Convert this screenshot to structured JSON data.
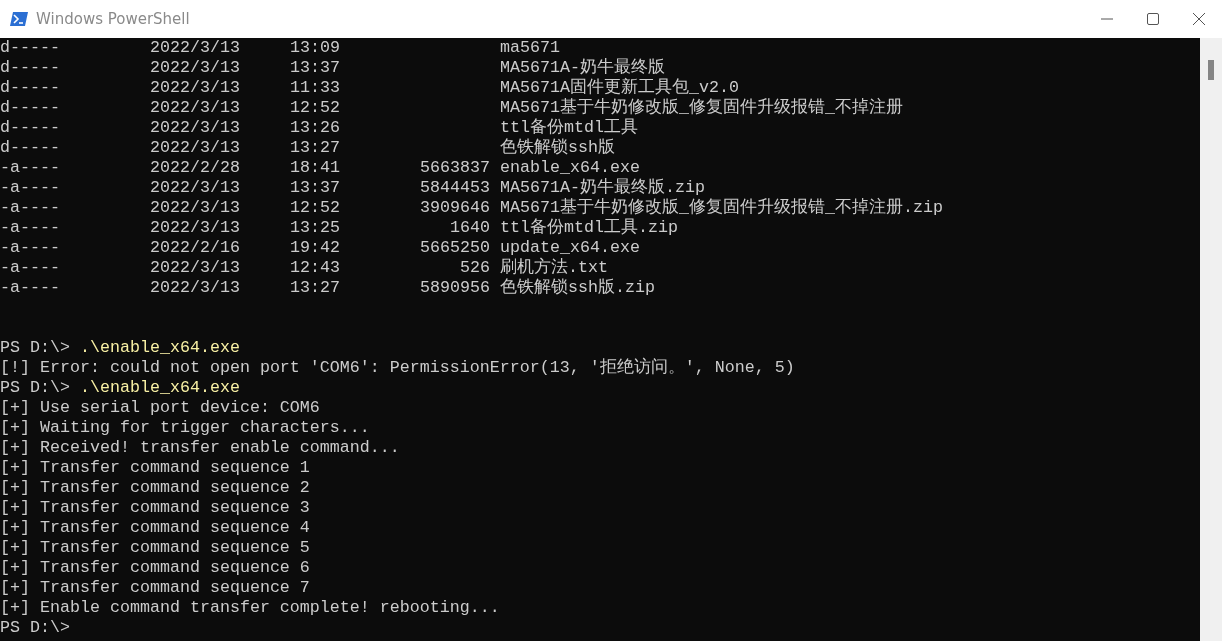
{
  "window": {
    "title": "Windows PowerShell"
  },
  "listing": [
    {
      "mode": "d-----",
      "date": "2022/3/13",
      "time": "13:09",
      "name": "ma5671"
    },
    {
      "mode": "d-----",
      "date": "2022/3/13",
      "time": "13:37",
      "name": "MA5671A-奶牛最终版"
    },
    {
      "mode": "d-----",
      "date": "2022/3/13",
      "time": "11:33",
      "name": "MA5671A固件更新工具包_v2.0"
    },
    {
      "mode": "d-----",
      "date": "2022/3/13",
      "time": "12:52",
      "name": "MA5671基于牛奶修改版_修复固件升级报错_不掉注册"
    },
    {
      "mode": "d-----",
      "date": "2022/3/13",
      "time": "13:26",
      "name": "ttl备份mtdl工具"
    },
    {
      "mode": "d-----",
      "date": "2022/3/13",
      "time": "13:27",
      "name": "色铁解锁ssh版"
    },
    {
      "mode": "-a----",
      "date": "2022/2/28",
      "time": "18:41",
      "length": "5663837",
      "name": "enable_x64.exe"
    },
    {
      "mode": "-a----",
      "date": "2022/3/13",
      "time": "13:37",
      "length": "5844453",
      "name": "MA5671A-奶牛最终版.zip"
    },
    {
      "mode": "-a----",
      "date": "2022/3/13",
      "time": "12:52",
      "length": "3909646",
      "name": "MA5671基于牛奶修改版_修复固件升级报错_不掉注册.zip"
    },
    {
      "mode": "-a----",
      "date": "2022/3/13",
      "time": "13:25",
      "length": "1640",
      "name": "ttl备份mtdl工具.zip"
    },
    {
      "mode": "-a----",
      "date": "2022/2/16",
      "time": "19:42",
      "length": "5665250",
      "name": "update_x64.exe"
    },
    {
      "mode": "-a----",
      "date": "2022/3/13",
      "time": "12:43",
      "length": "526",
      "name": "刷机方法.txt"
    },
    {
      "mode": "-a----",
      "date": "2022/3/13",
      "time": "13:27",
      "length": "5890956",
      "name": "色铁解锁ssh版.zip"
    }
  ],
  "session": [
    {
      "kind": "prompt",
      "prompt": "PS D:\\>",
      "command": ".\\enable_x64.exe"
    },
    {
      "kind": "output",
      "text": "[!] Error: could not open port 'COM6': PermissionError(13, '拒绝访问。', None, 5)"
    },
    {
      "kind": "prompt",
      "prompt": "PS D:\\>",
      "command": ".\\enable_x64.exe"
    },
    {
      "kind": "output",
      "text": "[+] Use serial port device: COM6"
    },
    {
      "kind": "output",
      "text": "[+] Waiting for trigger characters..."
    },
    {
      "kind": "output",
      "text": "[+] Received! transfer enable command..."
    },
    {
      "kind": "output",
      "text": "[+] Transfer command sequence 1"
    },
    {
      "kind": "output",
      "text": "[+] Transfer command sequence 2"
    },
    {
      "kind": "output",
      "text": "[+] Transfer command sequence 3"
    },
    {
      "kind": "output",
      "text": "[+] Transfer command sequence 4"
    },
    {
      "kind": "output",
      "text": "[+] Transfer command sequence 5"
    },
    {
      "kind": "output",
      "text": "[+] Transfer command sequence 6"
    },
    {
      "kind": "output",
      "text": "[+] Transfer command sequence 7"
    },
    {
      "kind": "output",
      "text": "[+] Enable command transfer complete! rebooting..."
    },
    {
      "kind": "prompt",
      "prompt": "PS D:\\>"
    }
  ]
}
